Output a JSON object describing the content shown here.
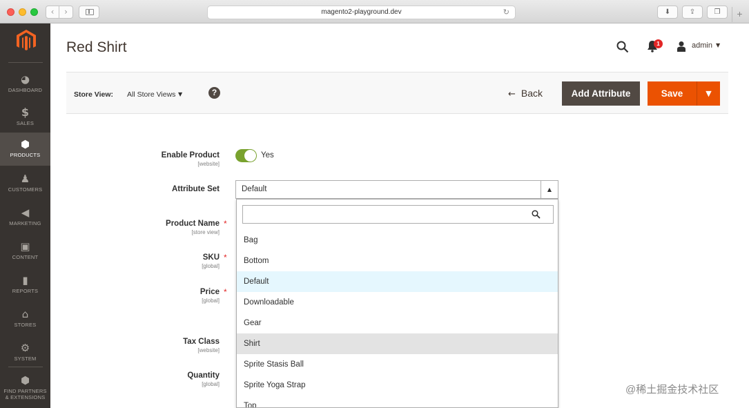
{
  "browser": {
    "url": "magento2-playground.dev"
  },
  "sidebar": {
    "items": [
      {
        "label": "DASHBOARD",
        "icon": "dashboard-icon"
      },
      {
        "label": "SALES",
        "icon": "dollar-icon"
      },
      {
        "label": "PRODUCTS",
        "icon": "cube-icon",
        "active": true
      },
      {
        "label": "CUSTOMERS",
        "icon": "person-icon"
      },
      {
        "label": "MARKETING",
        "icon": "megaphone-icon"
      },
      {
        "label": "CONTENT",
        "icon": "layout-icon"
      },
      {
        "label": "REPORTS",
        "icon": "bar-chart-icon"
      },
      {
        "label": "STORES",
        "icon": "storefront-icon"
      },
      {
        "label": "SYSTEM",
        "icon": "gear-icon"
      },
      {
        "label": "FIND PARTNERS",
        "label2": "& EXTENSIONS",
        "icon": "box-icon"
      }
    ]
  },
  "header": {
    "title": "Red Shirt",
    "notifications_count": "1",
    "username": "admin"
  },
  "actions": {
    "store_view_label": "Store View:",
    "store_view_value": "All Store Views",
    "help_label": "?",
    "back_label": "Back",
    "add_attribute_label": "Add Attribute",
    "save_label": "Save"
  },
  "form": {
    "enable_product": {
      "label": "Enable Product",
      "scope": "[website]",
      "value": "Yes"
    },
    "attribute_set": {
      "label": "Attribute Set",
      "value": "Default"
    },
    "product_name": {
      "label": "Product Name",
      "scope": "[store view]",
      "required": "*"
    },
    "sku": {
      "label": "SKU",
      "scope": "[global]",
      "required": "*"
    },
    "price": {
      "label": "Price",
      "scope": "[global]",
      "required": "*"
    },
    "tax_class": {
      "label": "Tax Class",
      "scope": "[website]"
    },
    "quantity": {
      "label": "Quantity",
      "scope": "[global]"
    }
  },
  "dropdown": {
    "search_placeholder": "",
    "options": [
      "Bag",
      "Bottom",
      "Default",
      "Downloadable",
      "Gear",
      "Shirt",
      "Sprite Stasis Ball",
      "Sprite Yoga Strap",
      "Top"
    ],
    "selected": "Default",
    "hovered": "Shirt"
  },
  "watermark": "@稀土掘金技术社区",
  "colors": {
    "sidebar_bg": "#373330",
    "accent_orange": "#eb5202",
    "toggle_green": "#79a22e",
    "dark_button": "#514943",
    "selected_option": "#e5f7fe"
  }
}
